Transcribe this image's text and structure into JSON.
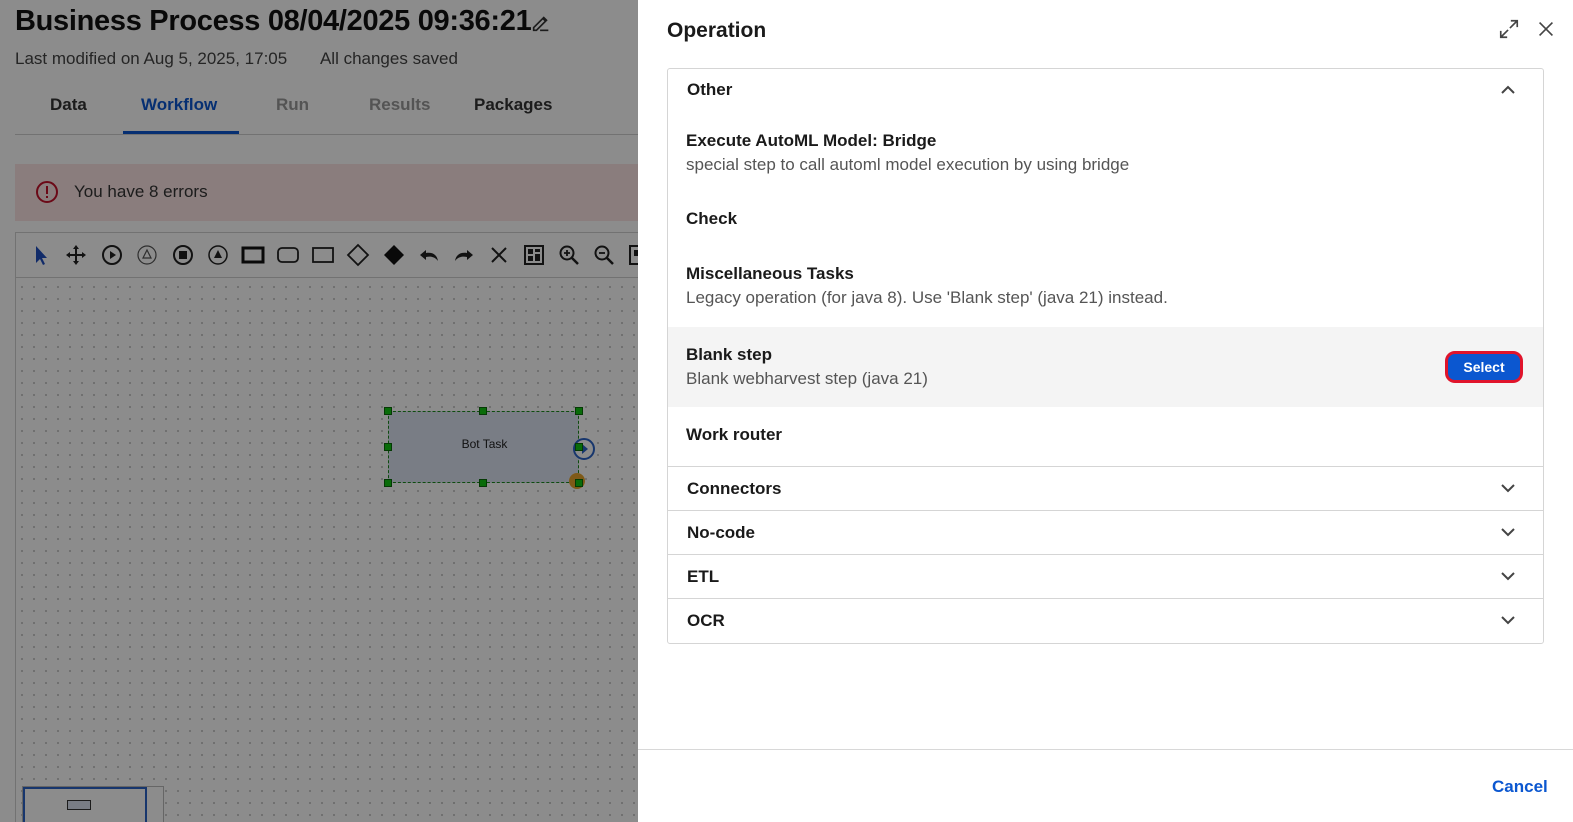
{
  "process": {
    "title": "Business Process 08/04/2025 09:36:21",
    "last_modified": "Last modified on Aug 5, 2025, 17:05",
    "save_status": "All changes saved"
  },
  "tabs": [
    {
      "label": "Data",
      "state": "normal"
    },
    {
      "label": "Workflow",
      "state": "active"
    },
    {
      "label": "Run",
      "state": "disabled"
    },
    {
      "label": "Results",
      "state": "disabled"
    },
    {
      "label": "Packages",
      "state": "normal"
    }
  ],
  "errors": {
    "message": "You have 8 errors"
  },
  "canvas": {
    "task_label": "Bot Task",
    "tools": [
      "pointer-icon",
      "move-icon",
      "start-event-icon",
      "signal-event-icon",
      "end-event-icon",
      "intermediate-event-icon",
      "task-icon",
      "rounded-task-icon",
      "subprocess-icon",
      "gateway-icon",
      "filled-gateway-icon",
      "undo-icon",
      "redo-icon",
      "delete-icon",
      "layout-icon",
      "zoom-in-icon",
      "zoom-out-icon",
      "fit-icon"
    ]
  },
  "drawer": {
    "title": "Operation",
    "groups": [
      {
        "label": "Other",
        "expanded": true
      },
      {
        "label": "Connectors",
        "expanded": false
      },
      {
        "label": "No-code",
        "expanded": false
      },
      {
        "label": "ETL",
        "expanded": false
      },
      {
        "label": "OCR",
        "expanded": false
      }
    ],
    "operations": [
      {
        "title": "Execute AutoML Model: Bridge",
        "description": "special step to call automl model execution by using bridge"
      },
      {
        "title": "Check",
        "description": ""
      },
      {
        "title": "Miscellaneous Tasks",
        "description": "Legacy operation (for java 8). Use 'Blank step' (java 21) instead."
      },
      {
        "title": "Blank step",
        "description": "Blank webharvest step (java 21)",
        "highlighted": true
      },
      {
        "title": "Work router",
        "description": ""
      }
    ],
    "select_label": "Select",
    "cancel_label": "Cancel"
  },
  "colors": {
    "accent": "#0b57d0",
    "error_bg": "#fbe4e4",
    "select_border": "#e0142b"
  }
}
